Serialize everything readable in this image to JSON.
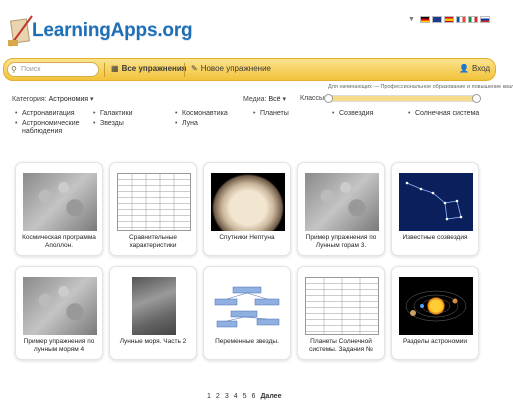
{
  "header": {
    "logo_text": "LearningApps.org",
    "languages": [
      "de",
      "en",
      "es",
      "fr",
      "it",
      "ru"
    ]
  },
  "toolbar": {
    "search_placeholder": "Поиск",
    "all_exercises": "Все упражнения",
    "new_exercise": "Новое упражнение",
    "login": "Вход"
  },
  "filters": {
    "category_label": "Категория:",
    "category_value": "Астрономия",
    "media_label": "Медиа:",
    "media_value": "Всё",
    "classes_label": "Классы:",
    "hint": "Для начинающих — Профессиональное образование и повышение квалиф"
  },
  "categories": [
    "Астронавигация",
    "Галактики",
    "Космонавтика",
    "Планеты",
    "Созвездия",
    "Солнечная система",
    "Астрономические наблюдения",
    "Звезды",
    "Луна"
  ],
  "cards": [
    {
      "caption": "Космическая программа Аполлон."
    },
    {
      "caption": "Сравнительные характеристики"
    },
    {
      "caption": "Спутники Нептуна"
    },
    {
      "caption": "Пример упражнения по Лунным горам 3."
    },
    {
      "caption": "Известные созвездия"
    },
    {
      "caption": "Пример упражнения по лунным морям 4"
    },
    {
      "caption": "Лунные моря. Часть 2"
    },
    {
      "caption": "Переменные звезды."
    },
    {
      "caption": "Планеты Солнечной системы. Задания №"
    },
    {
      "caption": "Разделы астрономии"
    }
  ],
  "pager": {
    "pages": [
      "1",
      "2",
      "3",
      "4",
      "5",
      "6"
    ],
    "next": "Далее"
  },
  "colors": {
    "accent": "#f2c23a",
    "logo": "#1f6fb7"
  }
}
